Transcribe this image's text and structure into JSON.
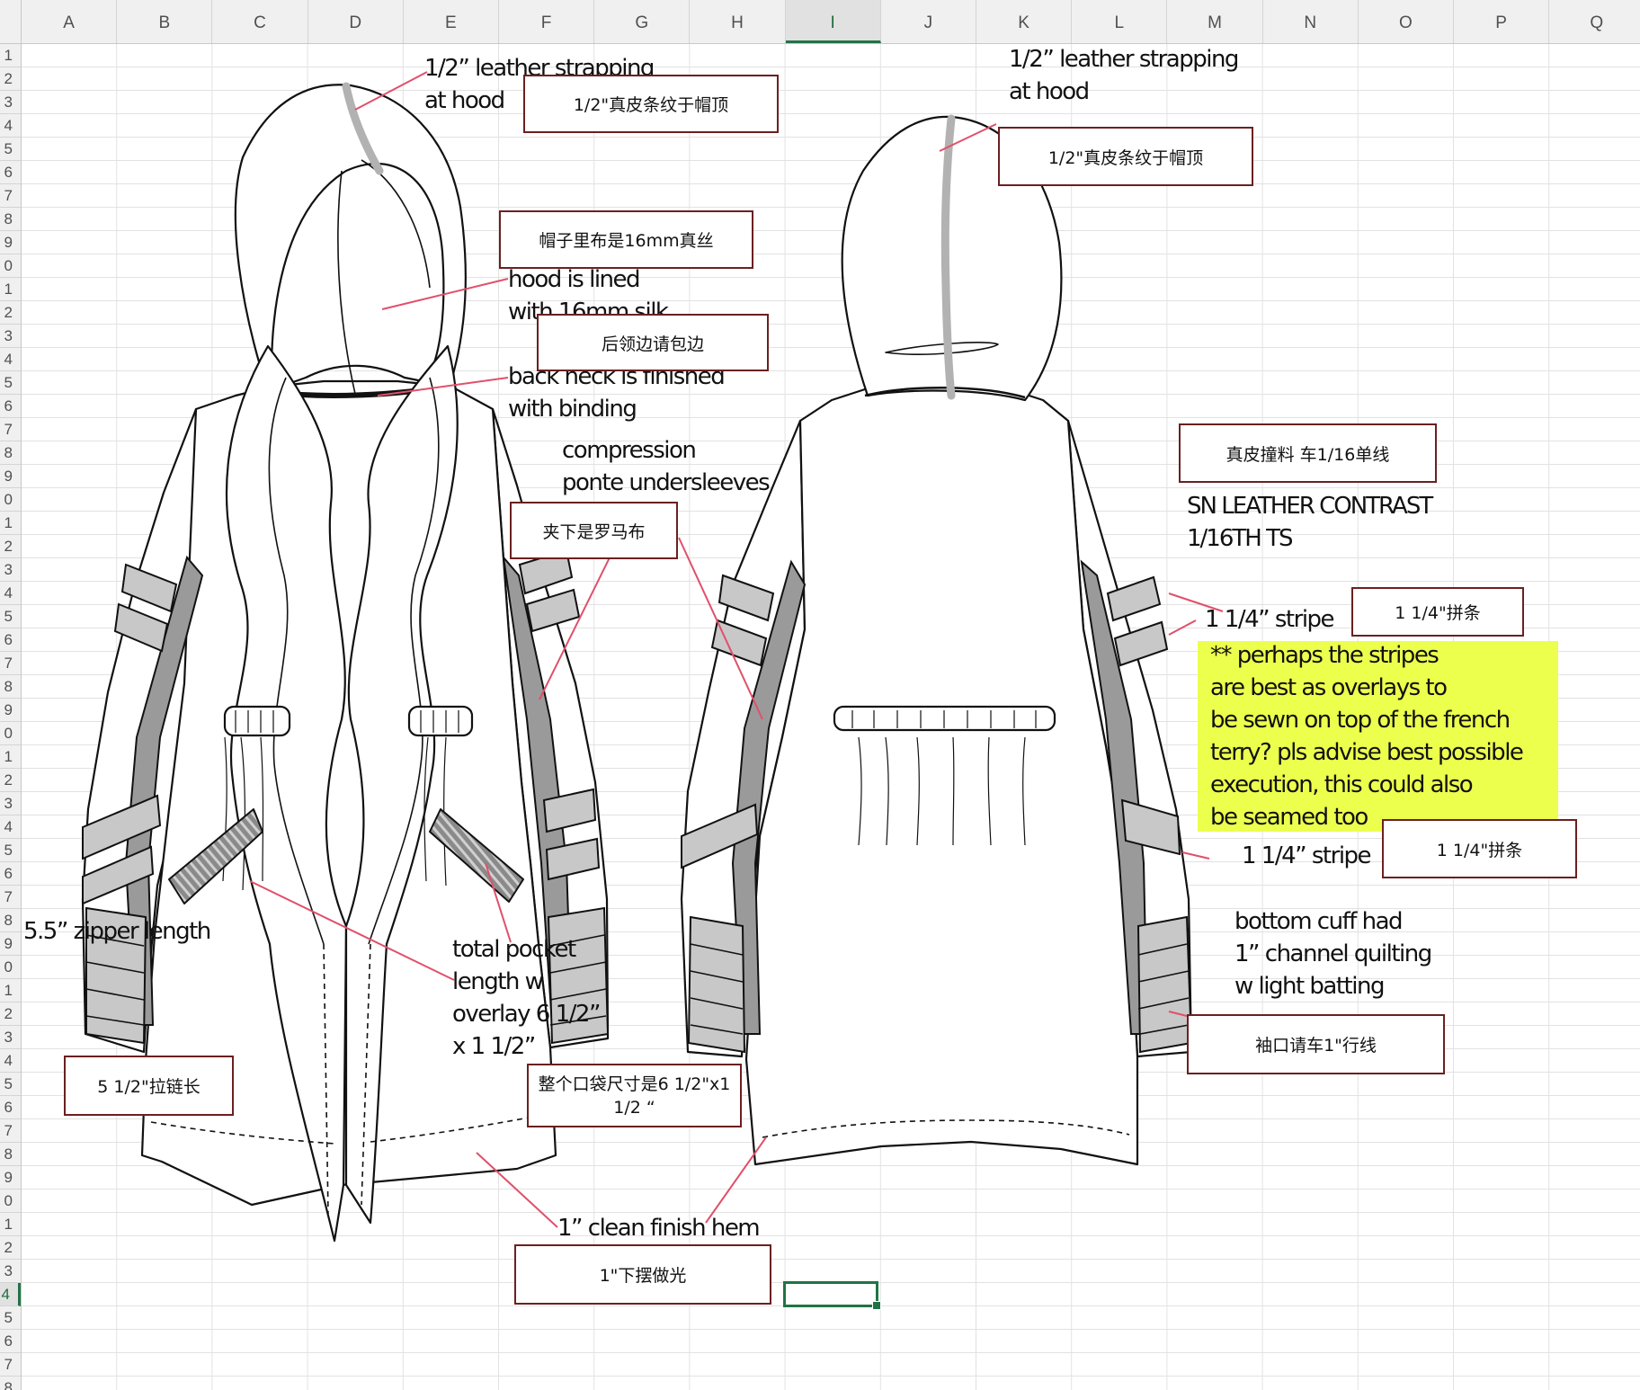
{
  "spreadsheet": {
    "columns": [
      "A",
      "B",
      "C",
      "D",
      "E",
      "F",
      "G",
      "H",
      "I",
      "J",
      "K",
      "L",
      "M",
      "N",
      "O",
      "P",
      "Q"
    ],
    "active_column": "I",
    "row_labels": [
      "1",
      "2",
      "3",
      "4",
      "5",
      "6",
      "7",
      "8",
      "9",
      "0",
      "1",
      "2",
      "3",
      "4",
      "5",
      "6",
      "7",
      "8",
      "9",
      "0",
      "1",
      "2",
      "3",
      "4",
      "5",
      "6",
      "7",
      "8",
      "9",
      "0",
      "1",
      "2",
      "3",
      "4",
      "5",
      "6",
      "7",
      "8",
      "9",
      "0",
      "1",
      "2",
      "3",
      "4",
      "5",
      "6",
      "7",
      "8",
      "9",
      "0",
      "1",
      "2",
      "3",
      "4",
      "5",
      "6",
      "7",
      "8"
    ],
    "active_row_index": 53,
    "colors": {
      "grid": "#e2e2e2",
      "header_bg": "#f0f0f0",
      "accent": "#217346"
    }
  },
  "annotations_en": {
    "leather_strap_front": "1/2” leather strapping\nat hood",
    "leather_strap_back": "1/2” leather strapping\nat hood",
    "hood_lined": "hood is lined\nwith 16mm silk",
    "back_neck": "back neck is finished\nwith binding",
    "compression": "compression\nponte undersleeves",
    "leather_contrast": "SN LEATHER CONTRAST\n1/16TH TS",
    "stripe_upper": "1 1/4” stripe",
    "stripe_note": "** perhaps the stripes\nare best as overlays to\nbe sewn on top of the french\nterry? pls advise best possible\nexecution, this could also\nbe seamed too",
    "stripe_lower": "1 1/4” stripe",
    "bottom_cuff": "bottom cuff had\n1” channel quilting\nw light batting",
    "zipper_length": "5.5” zipper length",
    "pocket_length": "total pocket\nlength w\noverlay 6 1/2”\nx 1 1/2”",
    "hem": "1” clean finish hem"
  },
  "annotations_cn": {
    "strap_front": "1/2\"真皮条纹于帽顶",
    "strap_back": "1/2\"真皮条纹于帽顶",
    "hood_lining": "帽子里布是16mm真丝",
    "back_neck": "后领边请包边",
    "underarm": "夹下是罗马布",
    "leather_contrast": "真皮撞料 车1/16单线",
    "stripe_upper": "1 1/4\"拼条",
    "stripe_lower": "1 1/4\"拼条",
    "cuff": "袖口请车1\"行线",
    "zipper": "5 1/2\"拉链长",
    "pocket": "整个口袋尺寸是6 1/2\"x1\n1/2 “",
    "hem": "1\"下摆做光"
  },
  "colors": {
    "callout_line": "#e0506a",
    "cn_box_border": "#6b2020",
    "highlight": "#ecff4d",
    "leather_gray": "#9a9a9a",
    "stripe_gray": "#c8c8c8",
    "line": "#111111"
  }
}
